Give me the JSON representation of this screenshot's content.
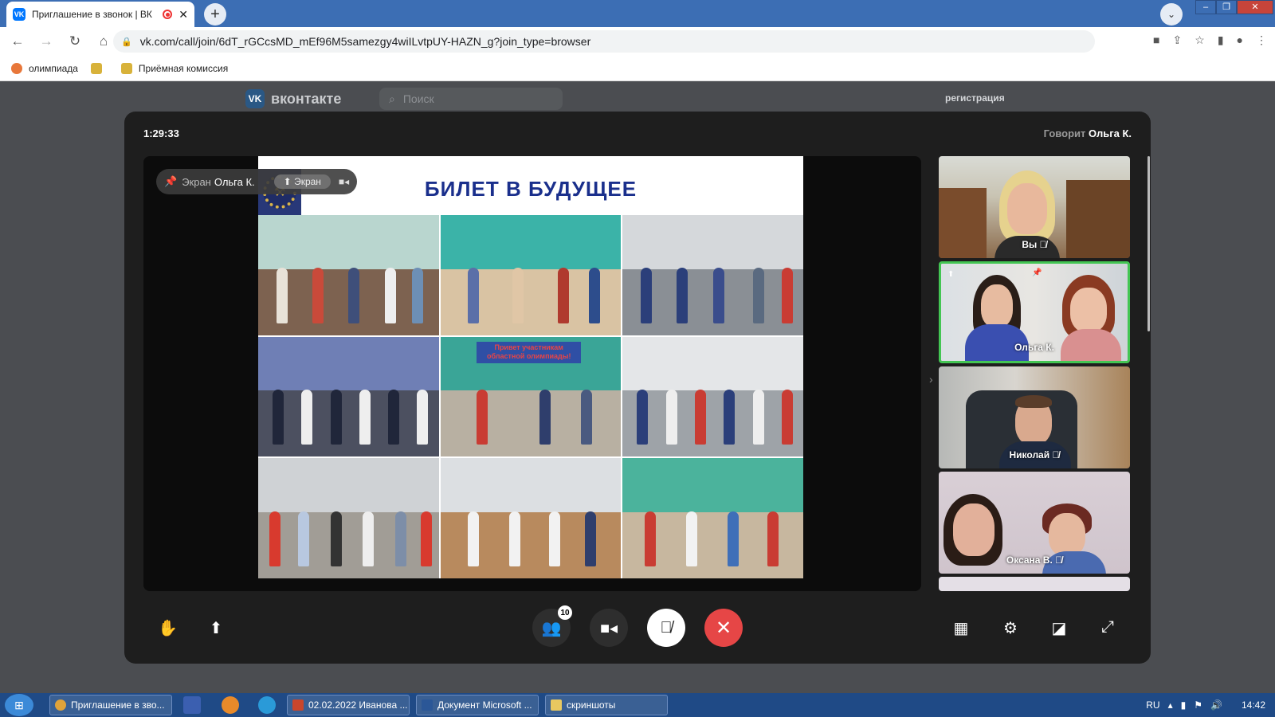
{
  "browser": {
    "tab_title": "Приглашение в звонок | ВК",
    "url": "vk.com/call/join/6dT_rGCcsMD_mEf96M5samezgy4wiILvtpUY-HAZN_g?join_type=browser",
    "bookmarks": [
      "олимпиада",
      "Приёмная комиссия"
    ]
  },
  "vk": {
    "logo_text": "вконтакте",
    "search_placeholder": "Поиск",
    "register_link": "регистрация"
  },
  "call": {
    "timer": "1:29:33",
    "speaking_label": "Говорит",
    "speaker_name": "Ольга К.",
    "screen_pill": {
      "label": "Экран",
      "owner": "Ольга К.",
      "sub_label": "Экран"
    },
    "slide_title": "БИЛЕТ В БУДУЩЕЕ",
    "slide_banner": "Привет участникам областной олимпиады!",
    "participants": [
      {
        "name": "Вы",
        "muted": true
      },
      {
        "name": "Ольга К.",
        "muted": false,
        "active": true
      },
      {
        "name": "Николай",
        "muted": true
      },
      {
        "name": "Оксана В.",
        "muted": true
      }
    ],
    "participant_count": "10"
  },
  "taskbar": {
    "items": [
      "Приглашение в зво...",
      "02.02.2022 Иванова ...",
      "Документ Microsoft ...",
      "скриншоты"
    ],
    "lang": "RU",
    "time": "14:42"
  },
  "colors": {
    "active_border": "#43c553",
    "hangup": "#e64646",
    "slide_title": "#1a2f8c"
  }
}
